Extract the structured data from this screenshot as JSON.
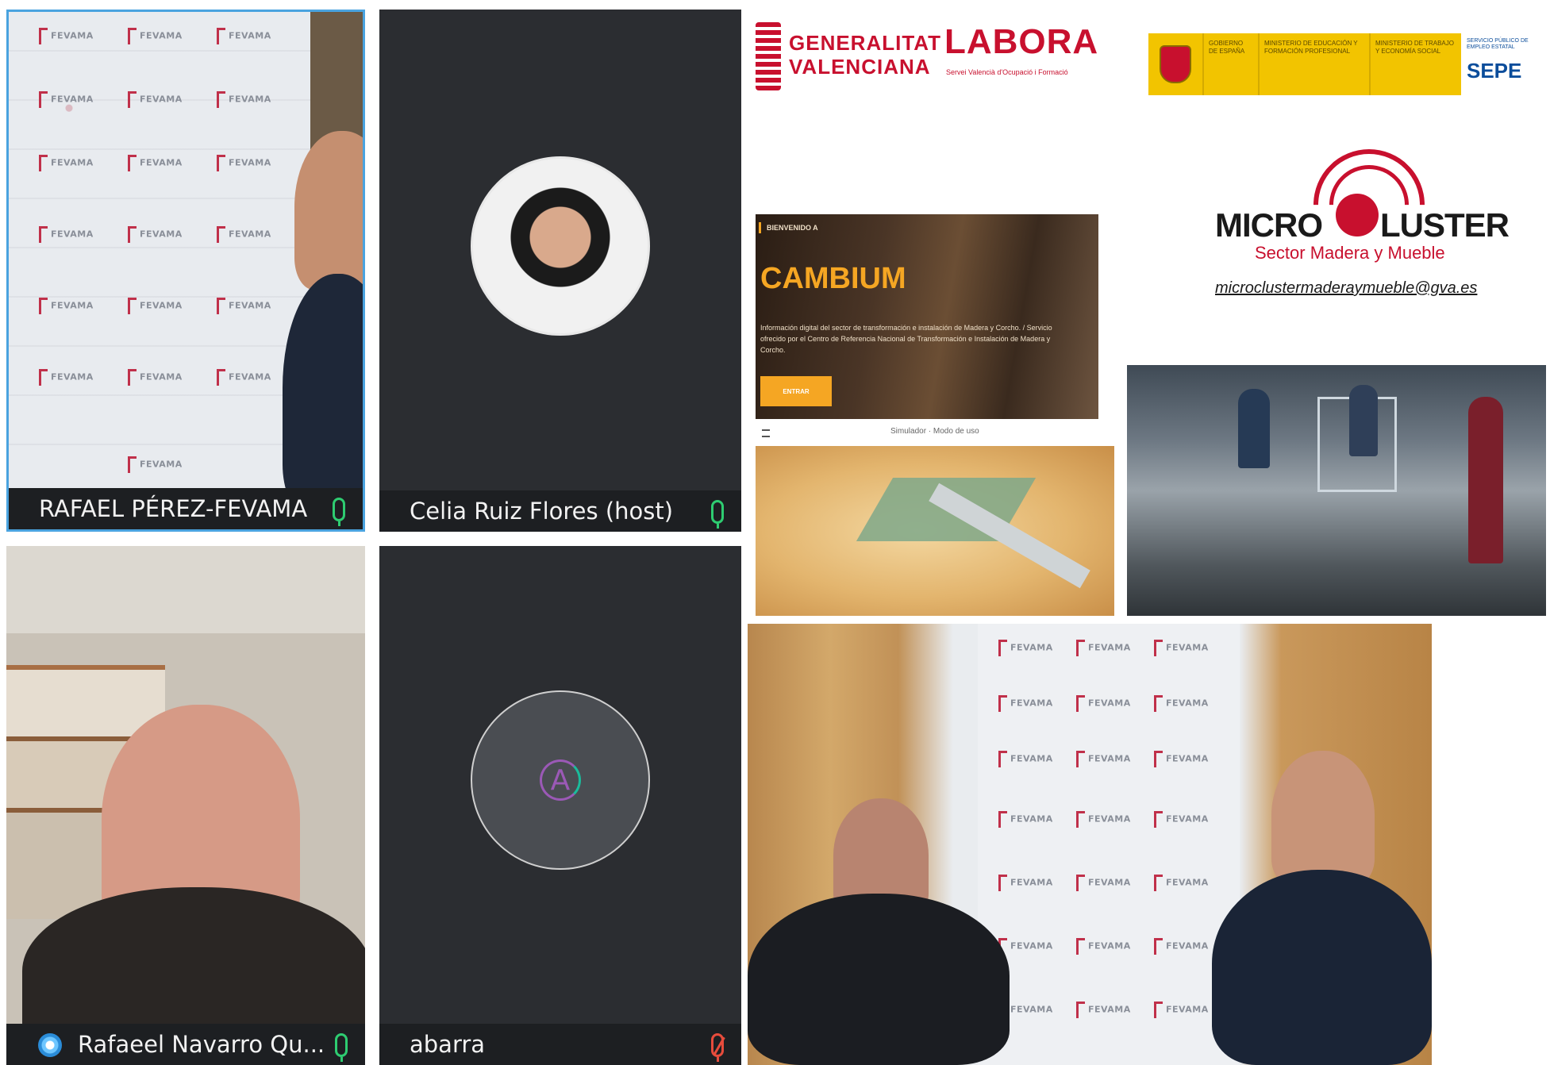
{
  "participants": [
    {
      "name": "RAFAEL PÉREZ-FEVAMA",
      "mic": "on",
      "active": true
    },
    {
      "name": "Celia Ruiz Flores (host)",
      "mic": "on",
      "active": false
    },
    {
      "name": "Rafaeel Navarro Qu...",
      "mic": "on",
      "active": false
    },
    {
      "name": "abarra",
      "mic": "muted",
      "active": false,
      "initial": "A"
    }
  ],
  "backdrop_logo": "FEVAMA",
  "sponsors": {
    "generalitat_line1": "GENERALITAT",
    "generalitat_line2": "VALENCIANA",
    "labora": "LABORA",
    "labora_sub": "Servei Valencià d'Ocupació i Formació",
    "gov_segments": [
      "GOBIERNO DE ESPAÑA",
      "MINISTERIO DE EDUCACIÓN Y FORMACIÓN PROFESIONAL",
      "MINISTERIO DE TRABAJO Y ECONOMÍA SOCIAL"
    ],
    "sepe_sub": "SERVICIO PÚBLICO DE EMPLEO ESTATAL",
    "sepe": "SEPE"
  },
  "microcluster": {
    "title_left": "MICRO",
    "title_right": "LUSTER",
    "subtitle": "Sector Madera y Mueble",
    "email": "microclustermaderaymueble@gva.es"
  },
  "cambium": {
    "eyebrow": "BIENVENIDO A",
    "title": "CAMBIUM",
    "description": "Información digital del sector de transformación e instalación de Madera y Corcho. / Servicio ofrecido por el Centro de Referencia Nacional de Transformación e Instalación de Madera y Corcho.",
    "button": "ENTRAR",
    "caption": "Simulador · Modo de uso"
  },
  "colors": {
    "tile_bg": "#2b2d31",
    "nameplate_bg": "#1d1f22",
    "active_border": "#4aa3df",
    "mic_on": "#2ecc71",
    "mic_muted": "#e74c3c",
    "brand_red": "#c8102e",
    "gov_yellow": "#f2c400",
    "cambium_orange": "#f5a623"
  },
  "icons": [
    "microphone-icon",
    "microphone-muted-icon",
    "avatar-initial",
    "shield-icon",
    "microcluster-arc-icon",
    "menu-icon"
  ]
}
